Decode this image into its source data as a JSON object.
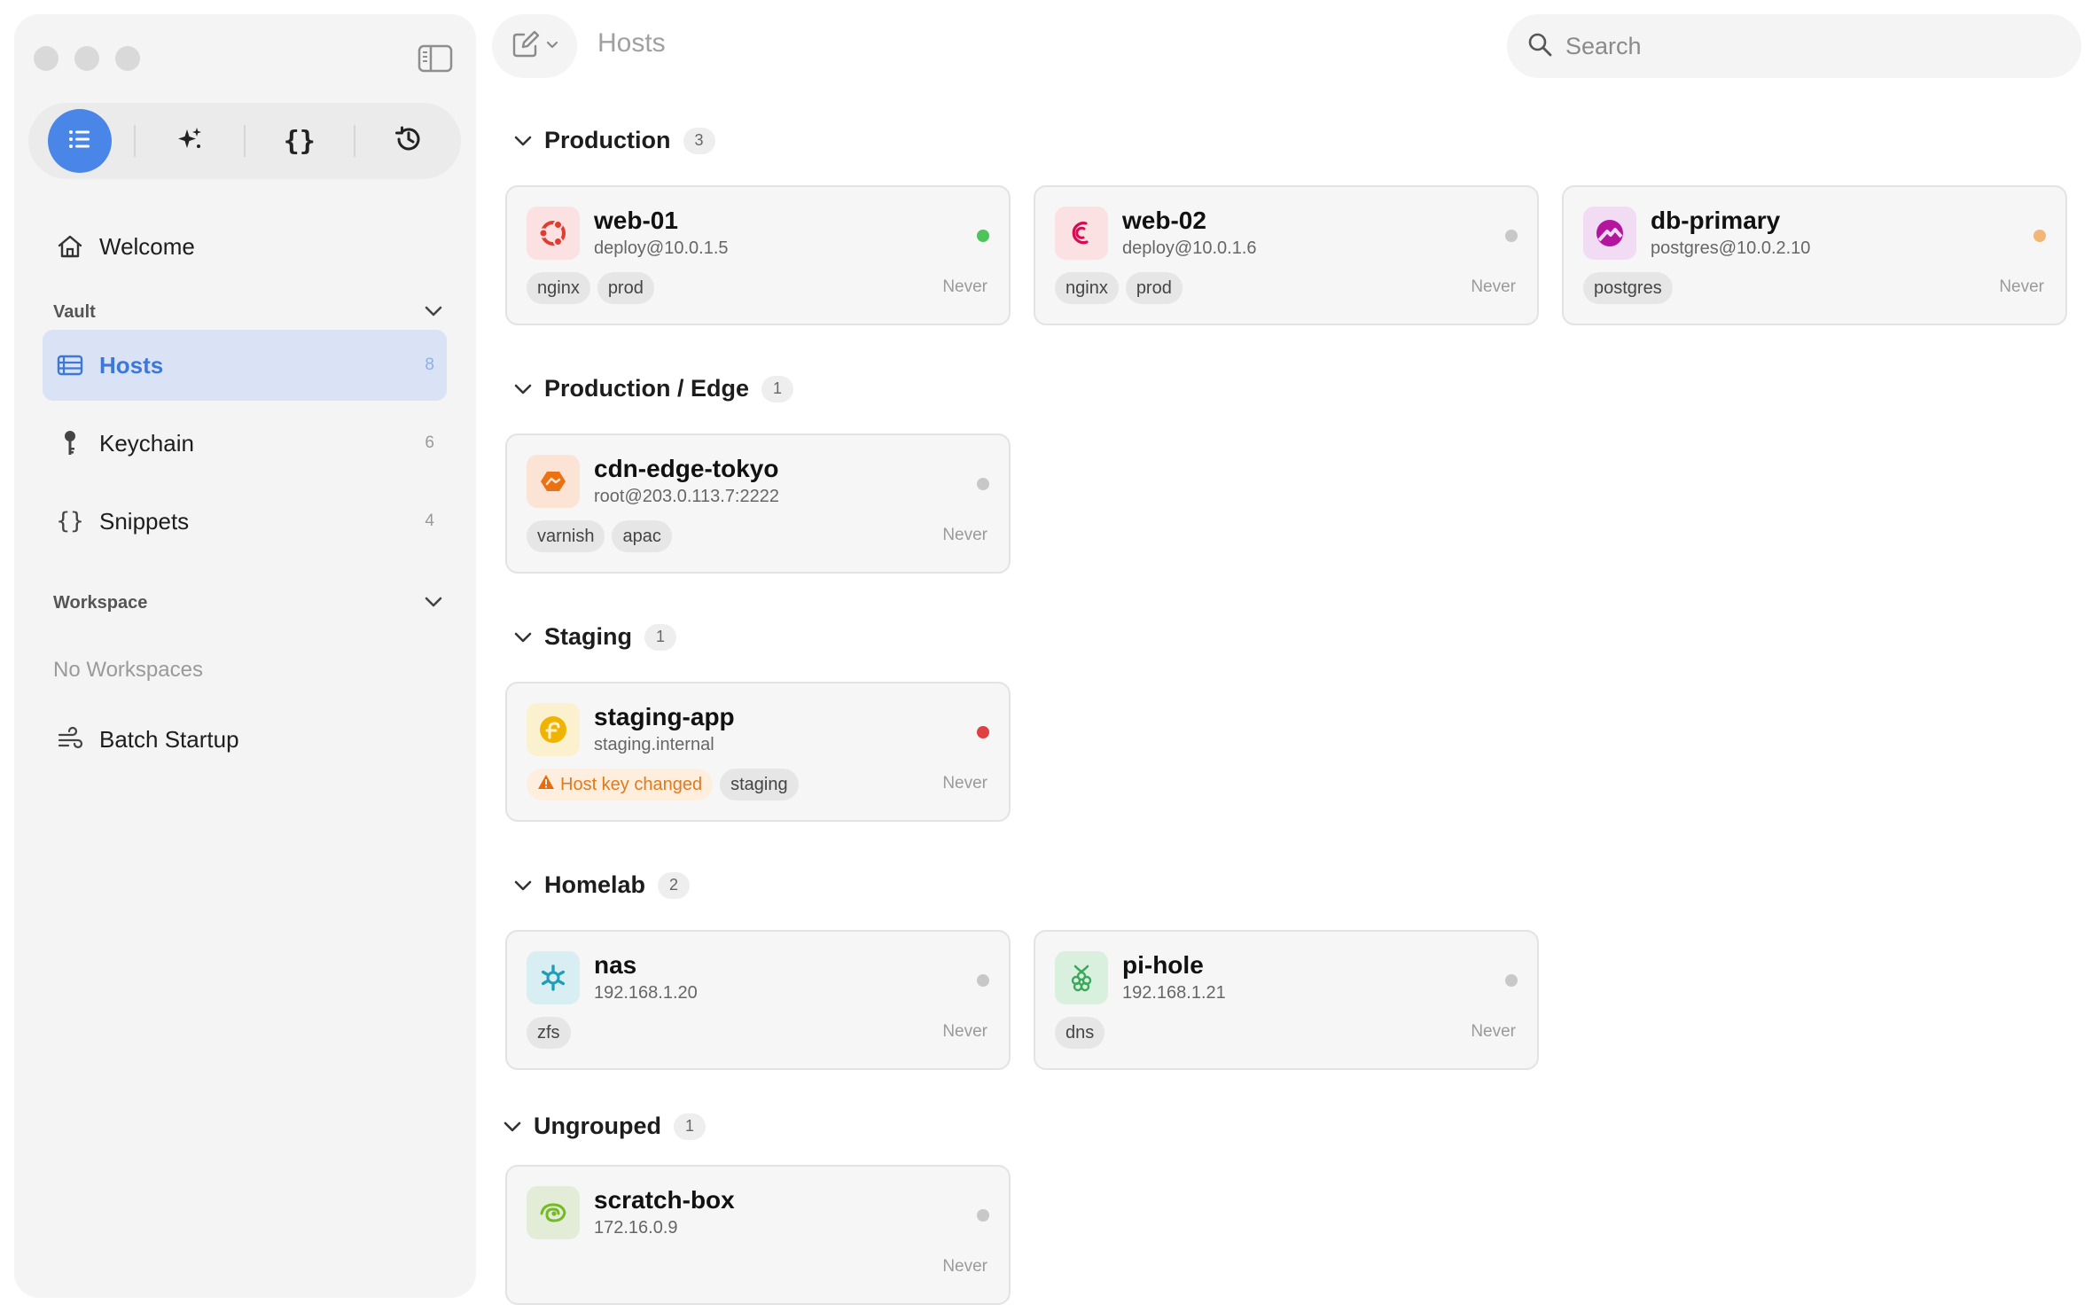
{
  "sidebar": {
    "tabs": [
      {
        "name": "list",
        "icon": "list-icon",
        "active": true
      },
      {
        "name": "ai",
        "icon": "sparkles-icon",
        "active": false
      },
      {
        "name": "snippets",
        "icon": "braces-icon",
        "active": false
      },
      {
        "name": "history",
        "icon": "history-icon",
        "active": false
      }
    ],
    "welcome": "Welcome",
    "vault_label": "Vault",
    "items": [
      {
        "label": "Hosts",
        "count": "8"
      },
      {
        "label": "Keychain",
        "count": "6"
      },
      {
        "label": "Snippets",
        "count": "4"
      }
    ],
    "workspace_label": "Workspace",
    "workspace_empty": "No Workspaces",
    "batch_startup": "Batch Startup"
  },
  "topbar": {
    "title": "Hosts",
    "search_placeholder": "Search"
  },
  "colors": {
    "accent": "#4a86e8",
    "online": "#4cc45a",
    "offline": "#c8c8c8",
    "warning": "#f3b676",
    "error": "#e04040"
  },
  "groups": [
    {
      "name": "Production",
      "count": "3"
    },
    {
      "name": "Production / Edge",
      "count": "1"
    },
    {
      "name": "Staging",
      "count": "1"
    },
    {
      "name": "Homelab",
      "count": "2"
    },
    {
      "name": "Ungrouped",
      "count": "1"
    }
  ],
  "hosts": [
    {
      "name": "web-01",
      "address": "deploy@10.0.1.5",
      "os_icon": "ubuntu-icon",
      "status": "online",
      "tags": [
        "nginx",
        "prod"
      ],
      "last": "Never"
    },
    {
      "name": "web-02",
      "address": "deploy@10.0.1.6",
      "os_icon": "debian-icon",
      "status": "offline",
      "tags": [
        "nginx",
        "prod"
      ],
      "last": "Never"
    },
    {
      "name": "db-primary",
      "address": "postgres@10.0.2.10",
      "os_icon": "rocky-icon",
      "status": "warning",
      "tags": [
        "postgres"
      ],
      "last": "Never"
    },
    {
      "name": "cdn-edge-tokyo",
      "address": "root@203.0.113.7:2222",
      "os_icon": "amazon-linux-icon",
      "status": "offline",
      "tags": [
        "varnish",
        "apac"
      ],
      "last": "Never"
    },
    {
      "name": "staging-app",
      "address": "staging.internal",
      "os_icon": "fedora-icon",
      "status": "error",
      "warning_tag": "Host key changed",
      "tags": [
        "staging"
      ],
      "last": "Never"
    },
    {
      "name": "nas",
      "address": "192.168.1.20",
      "os_icon": "nixos-icon",
      "status": "offline",
      "tags": [
        "zfs"
      ],
      "last": "Never"
    },
    {
      "name": "pi-hole",
      "address": "192.168.1.21",
      "os_icon": "raspberry-pi-icon",
      "status": "offline",
      "tags": [
        "dns"
      ],
      "last": "Never"
    },
    {
      "name": "scratch-box",
      "address": "172.16.0.9",
      "os_icon": "opensuse-icon",
      "status": "offline",
      "tags": [],
      "last": "Never"
    }
  ]
}
